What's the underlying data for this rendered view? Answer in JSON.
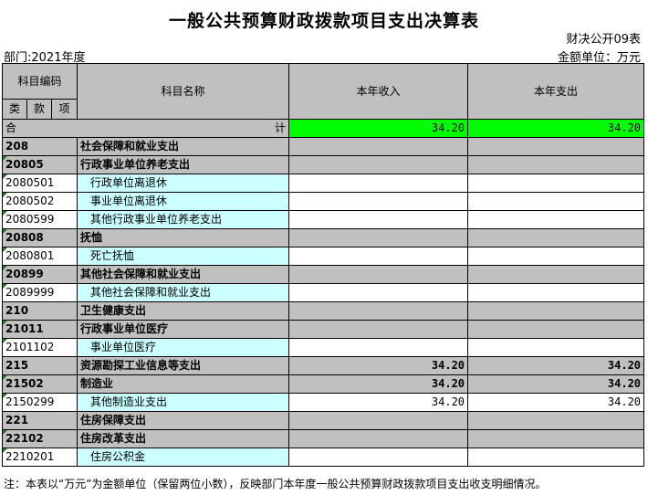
{
  "header": {
    "title": "一般公共预算财政拨款项目支出决算表",
    "form_no": "财决公开09表",
    "department": "部门:2021年度",
    "unit": "金额单位：万元"
  },
  "columns": {
    "subject_code": "科目编码",
    "class": "类",
    "section": "款",
    "item": "项",
    "subject_name": "科目名称",
    "income": "本年收入",
    "expense": "本年支出"
  },
  "total": {
    "label_left": "合",
    "label_right": "计",
    "income": "34.20",
    "expense": "34.20"
  },
  "rows": [
    {
      "code": "208",
      "name": "社会保障和就业支出",
      "income": "",
      "expense": ""
    },
    {
      "code": "20805",
      "name": "行政事业单位养老支出",
      "income": "",
      "expense": ""
    },
    {
      "code": "2080501",
      "name": "行政单位离退休",
      "income": "",
      "expense": ""
    },
    {
      "code": "2080502",
      "name": "事业单位离退休",
      "income": "",
      "expense": ""
    },
    {
      "code": "2080599",
      "name": "其他行政事业单位养老支出",
      "income": "",
      "expense": ""
    },
    {
      "code": "20808",
      "name": "抚恤",
      "income": "",
      "expense": ""
    },
    {
      "code": "2080801",
      "name": "死亡抚恤",
      "income": "",
      "expense": ""
    },
    {
      "code": "20899",
      "name": "其他社会保障和就业支出",
      "income": "",
      "expense": ""
    },
    {
      "code": "2089999",
      "name": "其他社会保障和就业支出",
      "income": "",
      "expense": ""
    },
    {
      "code": "210",
      "name": "卫生健康支出",
      "income": "",
      "expense": ""
    },
    {
      "code": "21011",
      "name": "行政事业单位医疗",
      "income": "",
      "expense": ""
    },
    {
      "code": "2101102",
      "name": "事业单位医疗",
      "income": "",
      "expense": ""
    },
    {
      "code": "215",
      "name": "资源勘探工业信息等支出",
      "income": "34.20",
      "expense": "34.20"
    },
    {
      "code": "21502",
      "name": "制造业",
      "income": "34.20",
      "expense": "34.20"
    },
    {
      "code": "2150299",
      "name": "其他制造业支出",
      "income": "34.20",
      "expense": "34.20"
    },
    {
      "code": "221",
      "name": "住房保障支出",
      "income": "",
      "expense": ""
    },
    {
      "code": "22102",
      "name": "住房改革支出",
      "income": "",
      "expense": ""
    },
    {
      "code": "2210201",
      "name": "住房公积金",
      "income": "",
      "expense": ""
    }
  ],
  "footer": {
    "note": "注：本表以“万元”为金额单位（保留两位小数），反映部门本年度一般公共预算财政拨款项目支出收支明细情况。"
  }
}
